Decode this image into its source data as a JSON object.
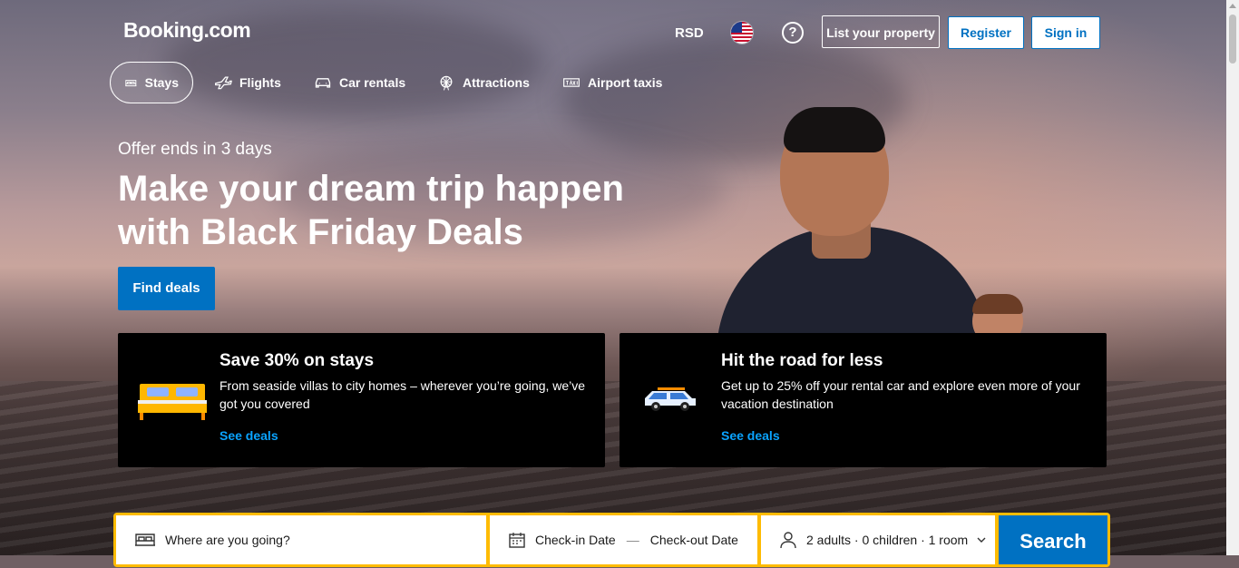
{
  "header": {
    "logo": "Booking.com",
    "currency": "RSD",
    "help_icon_glyph": "?",
    "list_property": "List your property",
    "register": "Register",
    "sign_in": "Sign in"
  },
  "nav": {
    "items": [
      {
        "label": "Stays",
        "icon": "bed-icon",
        "active": true
      },
      {
        "label": "Flights",
        "icon": "plane-icon",
        "active": false
      },
      {
        "label": "Car rentals",
        "icon": "car-icon",
        "active": false
      },
      {
        "label": "Attractions",
        "icon": "ferris-wheel-icon",
        "active": false
      },
      {
        "label": "Airport taxis",
        "icon": "taxi-icon",
        "active": false
      }
    ]
  },
  "hero": {
    "offer": "Offer ends in 3 days",
    "headline": "Make your dream trip happen with Black Friday Deals",
    "cta": "Find deals"
  },
  "cards": [
    {
      "title": "Save 30% on stays",
      "description": "From seaside villas to city homes – wherever you’re going, we’ve got you covered",
      "link": "See deals",
      "illustration": "bed-illustration"
    },
    {
      "title": "Hit the road for less",
      "description": "Get up to 25% off your rental car and explore even more of your vacation destination",
      "link": "See deals",
      "illustration": "car-illustration"
    }
  ],
  "search": {
    "destination_placeholder": "Where are you going?",
    "checkin": "Check-in Date",
    "date_separator": "—",
    "checkout": "Check-out Date",
    "guests": "2 adults · 0 children · 1 room",
    "button": "Search"
  },
  "colors": {
    "brand_blue": "#0071c2",
    "search_yellow": "#febb02",
    "link_blue": "#0aa3ff",
    "card_bg": "#000000"
  }
}
